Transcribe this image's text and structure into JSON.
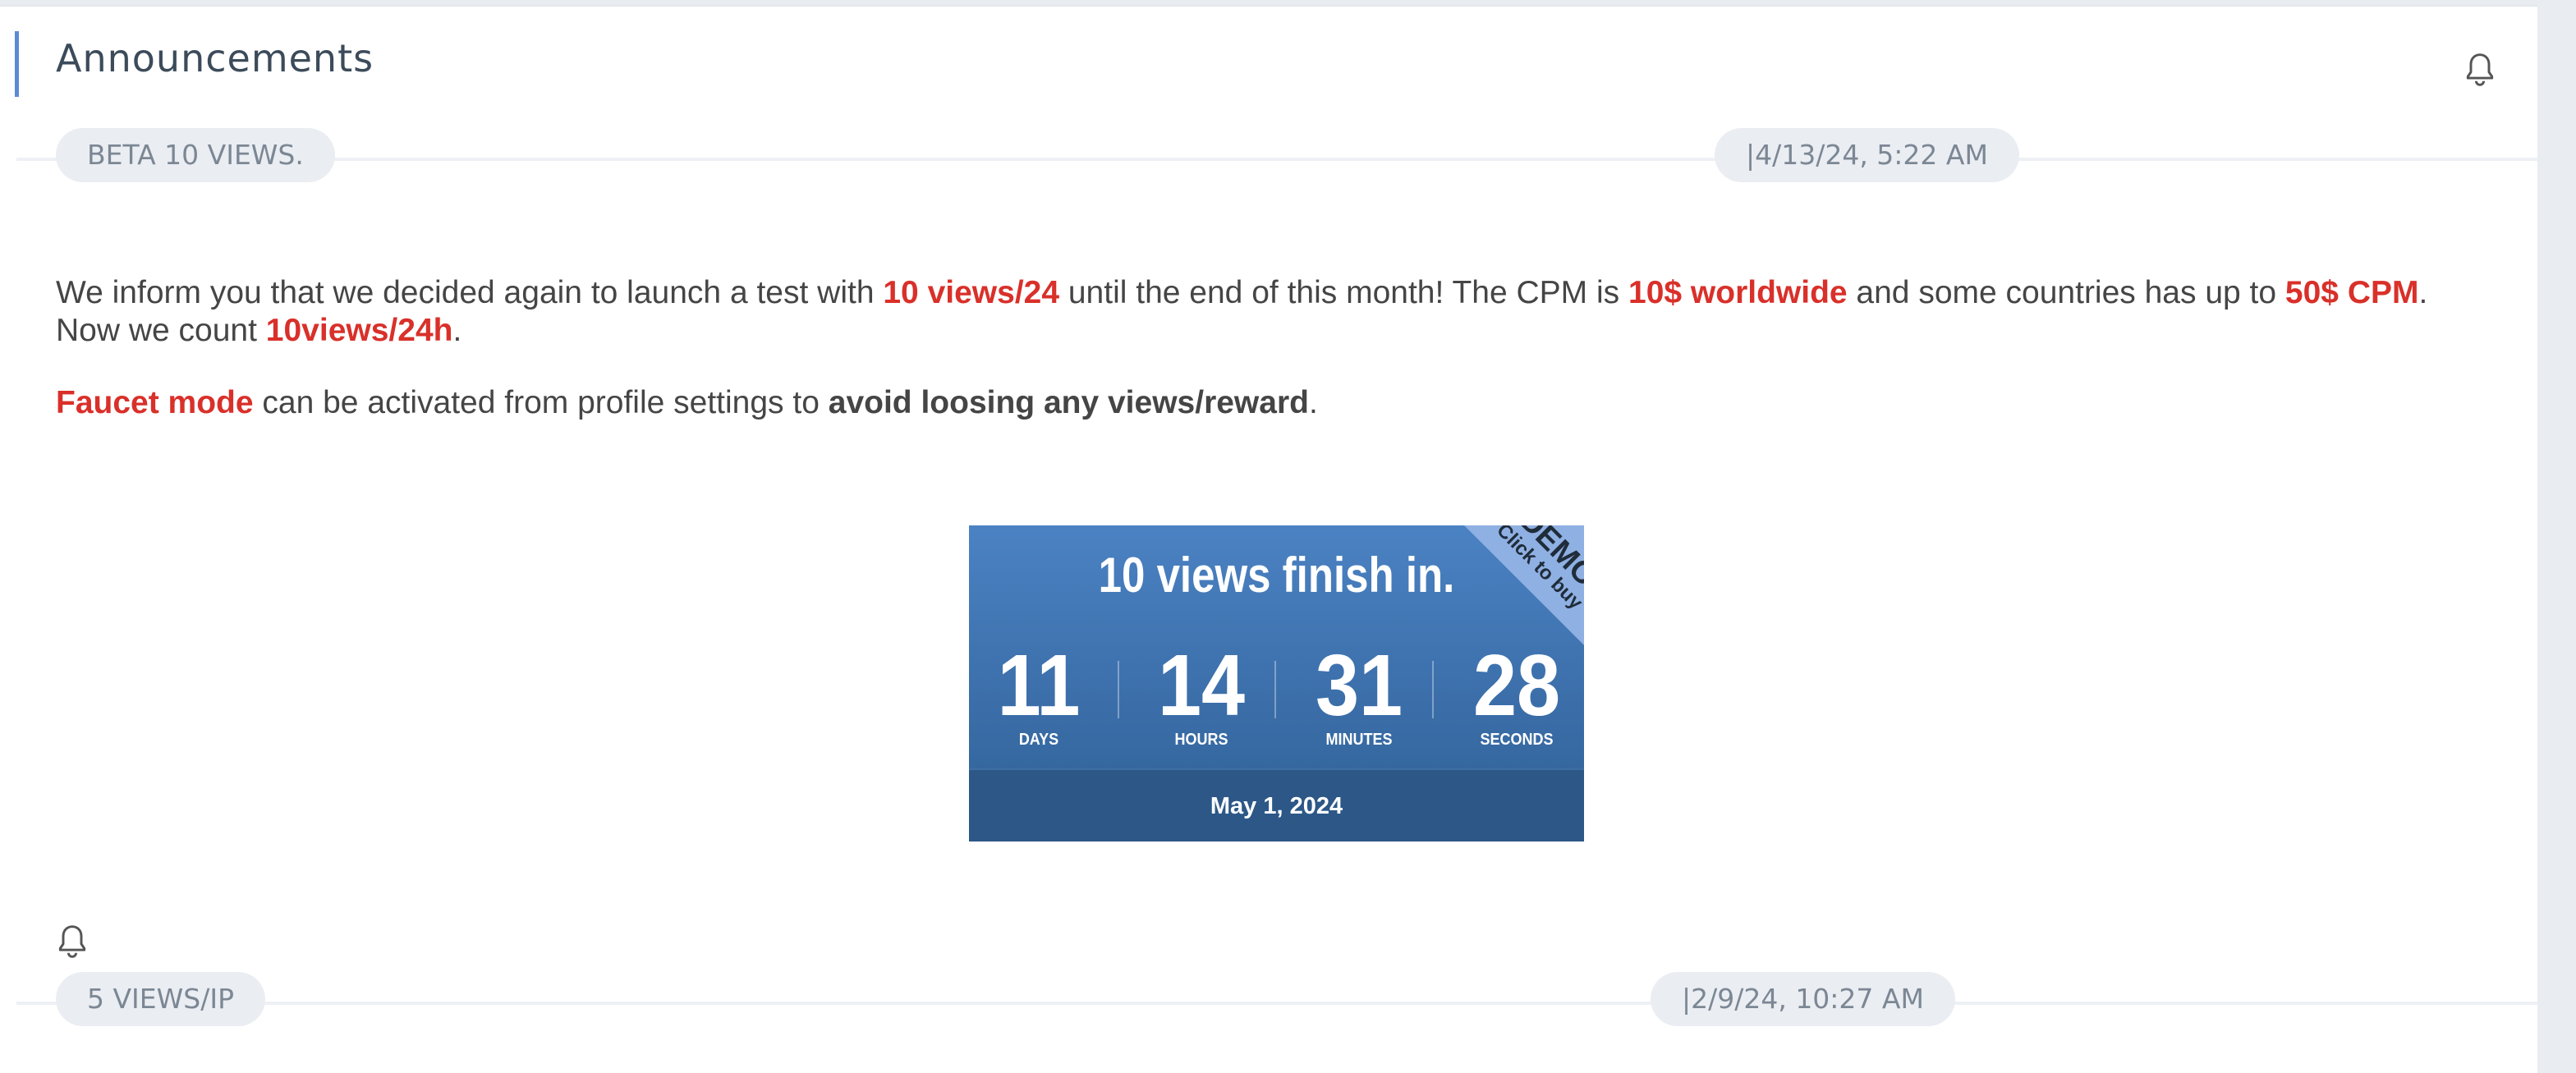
{
  "header": {
    "title": "Announcements"
  },
  "announcements": [
    {
      "tag": "BETA 10 VIEWS.",
      "date": "|4/13/24, 5:22 AM",
      "p1": [
        {
          "t": "We inform you that we decided again to launch a test with ",
          "s": "n"
        },
        {
          "t": "10 views/24",
          "s": "r"
        },
        {
          "t": " until the end of this month! The CPM is ",
          "s": "n"
        },
        {
          "t": "10$ worldwide",
          "s": "r"
        },
        {
          "t": " and some countries has up to ",
          "s": "n"
        },
        {
          "t": "50$ CPM",
          "s": "r"
        },
        {
          "t": ". Now we count ",
          "s": "n"
        },
        {
          "t": "10views/24h",
          "s": "r"
        },
        {
          "t": ".",
          "s": "n"
        }
      ],
      "p2": [
        {
          "t": " Faucet mode",
          "s": "r"
        },
        {
          "t": " can be activated from profile settings to ",
          "s": "n"
        },
        {
          "t": "avoid loosing any views/reward",
          "s": "b"
        },
        {
          "t": ".",
          "s": "n"
        }
      ],
      "countdown": {
        "title": "10 views finish in.",
        "ribbon_top": "DEMO",
        "ribbon_bottom": "Click to buy",
        "units": [
          {
            "value": "11",
            "label": "DAYS"
          },
          {
            "value": "14",
            "label": "HOURS"
          },
          {
            "value": "31",
            "label": "MINUTES"
          },
          {
            "value": "28",
            "label": "SECONDS"
          }
        ],
        "end_date": "May 1, 2024"
      }
    },
    {
      "tag": "5 VIEWS/IP",
      "date": "|2/9/24, 10:27 AM"
    }
  ],
  "icons": {
    "header": "bell-icon",
    "second_announcement": "bell-icon"
  },
  "colors": {
    "accent": "#5b8bd6",
    "highlight_red": "#d9302a",
    "timer_blue": "#3d6ea4"
  }
}
